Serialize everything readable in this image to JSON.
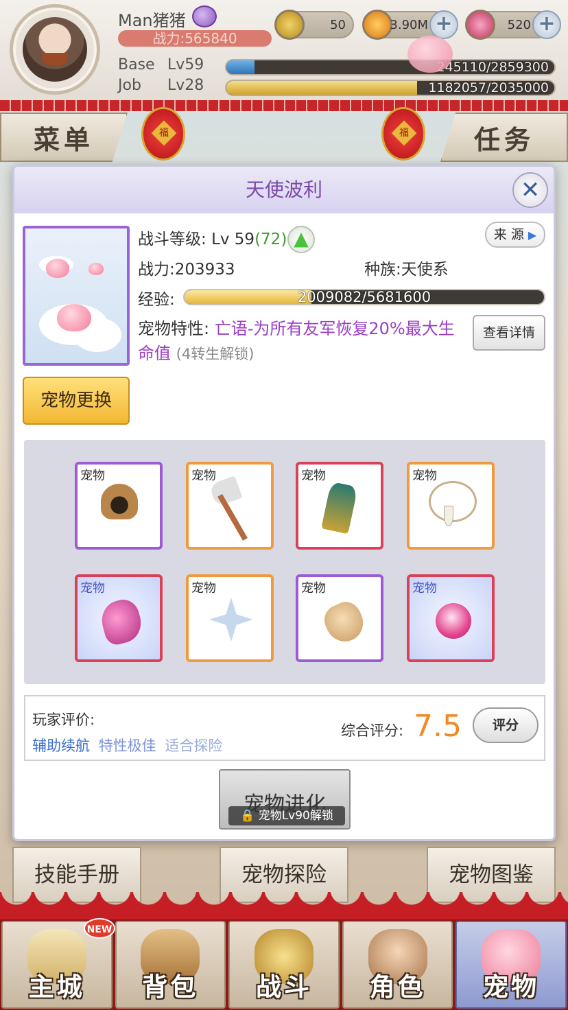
{
  "header": {
    "player_name": "Man猪猪",
    "power": "战力:565840",
    "base_label": "Base",
    "base_level": "Lv59",
    "base_exp": "245110/2859300",
    "base_progress": 0.0857,
    "job_label": "Job",
    "job_level": "Lv28",
    "job_exp": "1182057/2035000",
    "job_progress": 0.581
  },
  "currencies": [
    {
      "name": "zeny",
      "value": "50",
      "icon": "z-coin-icon",
      "color": "#d8b13b"
    },
    {
      "name": "gold",
      "value": "3.90M",
      "icon": "gold-pouch-icon",
      "color": "#e09a2a"
    },
    {
      "name": "gem",
      "value": "520",
      "icon": "pink-gem-icon",
      "color": "#d8507a"
    }
  ],
  "side_tabs": {
    "menu": "菜单",
    "quest": "任务"
  },
  "lantern_char": "福",
  "modal": {
    "title": "天使波利",
    "close_icon": "close-icon",
    "battle_level_label": "战斗等级:",
    "battle_level": "Lv 59",
    "battle_level_max": "(72)",
    "source_label": "来 源",
    "power_label": "战力:",
    "power_value": "203933",
    "race_label": "种族:",
    "race_value": "天使系",
    "exp_label": "经验:",
    "exp_value": "2009082/5681600",
    "exp_progress": 0.3536,
    "trait_label": "宠物特性:",
    "trait_value": "亡语-为所有友军恢复20%最大生命值",
    "trait_lock": "(4转生解锁)",
    "detail_button": "查看详情",
    "swap_button": "宠物更换",
    "equip_tag": "宠物",
    "equipment": [
      {
        "item": "horned-hood",
        "rarity": "purple",
        "glow": false
      },
      {
        "item": "axe",
        "rarity": "orange",
        "glow": false
      },
      {
        "item": "glove",
        "rarity": "red",
        "glow": false
      },
      {
        "item": "fang-necklace",
        "rarity": "orange",
        "glow": false
      },
      {
        "item": "pink-crystal",
        "rarity": "red",
        "glow": true
      },
      {
        "item": "shuriken",
        "rarity": "orange",
        "glow": false
      },
      {
        "item": "paw",
        "rarity": "purple",
        "glow": false
      },
      {
        "item": "pink-orb",
        "rarity": "red",
        "glow": true
      }
    ],
    "player_review_label": "玩家评价:",
    "review_tags": [
      {
        "text": "辅助续航",
        "color": "#3c6fd0"
      },
      {
        "text": "特性极佳",
        "color": "#7b92d8"
      },
      {
        "text": "适合探险",
        "color": "#9aaade"
      }
    ],
    "score_label": "综合评分:",
    "score_value": "7.5",
    "rate_button": "评分",
    "evolve_button": "宠物进化",
    "evolve_lock": "宠物Lv90解锁"
  },
  "lower_buttons": {
    "skill_book": "技能手册",
    "explore": "宠物探险",
    "codex": "宠物图鉴"
  },
  "bottom_nav": [
    {
      "label": "主城",
      "icon": "castle-icon",
      "badge": "NEW"
    },
    {
      "label": "背包",
      "icon": "backpack-icon"
    },
    {
      "label": "战斗",
      "icon": "battle-emblem-icon"
    },
    {
      "label": "角色",
      "icon": "character-icon"
    },
    {
      "label": "宠物",
      "icon": "pet-icon",
      "active": true
    }
  ]
}
